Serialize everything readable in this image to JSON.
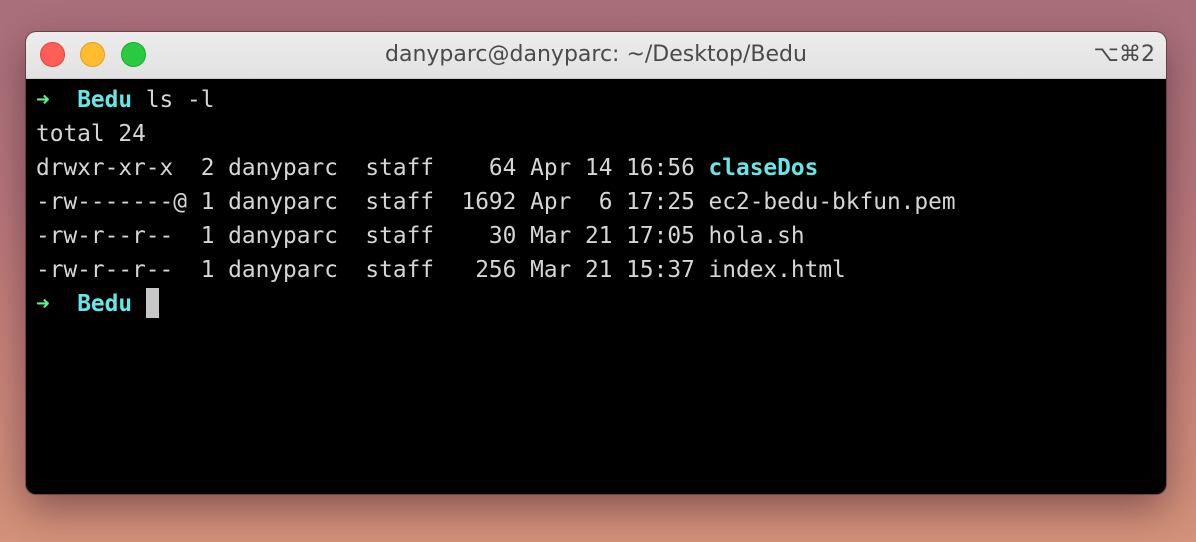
{
  "window": {
    "title": "danyparc@danyparc: ~/Desktop/Bedu",
    "shortcut": "⌥⌘2"
  },
  "terminal": {
    "prompt1": {
      "arrow": "➜",
      "dir": "Bedu",
      "command": "ls -l"
    },
    "total": "total 24",
    "entries": [
      {
        "meta": "drwxr-xr-x  2 danyparc  staff    64 Apr 14 16:56",
        "name": "claseDos"
      },
      {
        "meta": "-rw-------@ 1 danyparc  staff  1692 Apr  6 17:25",
        "name": "ec2-bedu-bkfun.pem"
      },
      {
        "meta": "-rw-r--r--  1 danyparc  staff    30 Mar 21 17:05",
        "name": "hola.sh"
      },
      {
        "meta": "-rw-r--r--  1 danyparc  staff   256 Mar 21 15:37",
        "name": "index.html"
      }
    ],
    "prompt2": {
      "arrow": "➜",
      "dir": "Bedu"
    }
  },
  "colors": {
    "prompt_arrow": "#5ff089",
    "directory": "#67e6e6",
    "text": "#d6d6d6",
    "background": "#000000"
  }
}
